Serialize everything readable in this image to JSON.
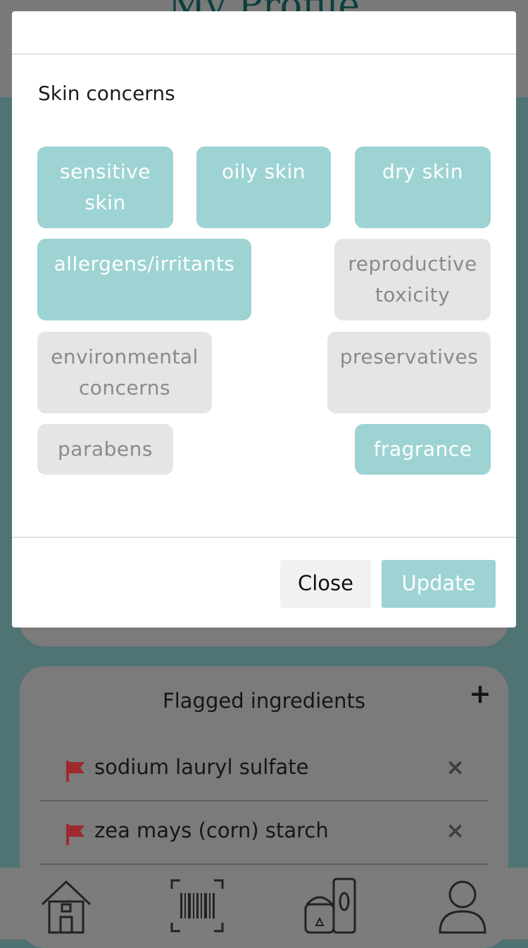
{
  "page": {
    "title": "My Profile"
  },
  "modal": {
    "section_title": "Skin concerns",
    "chips": [
      {
        "label": "sensitive skin",
        "selected": true
      },
      {
        "label": "oily skin",
        "selected": true
      },
      {
        "label": "dry skin",
        "selected": true
      },
      {
        "label": "allergens/irritants",
        "selected": true
      },
      {
        "label": "reproductive toxicity",
        "selected": false
      },
      {
        "label": "environmental concerns",
        "selected": false
      },
      {
        "label": "preservatives",
        "selected": false
      },
      {
        "label": "parabens",
        "selected": false
      },
      {
        "label": "fragrance",
        "selected": true
      }
    ],
    "close_label": "Close",
    "update_label": "Update"
  },
  "flagged": {
    "title": "Flagged ingredients",
    "add_label": "+",
    "items": [
      {
        "name": "sodium lauryl sulfate",
        "remove": "×"
      },
      {
        "name": "zea mays (corn) starch",
        "remove": "×"
      }
    ]
  },
  "tabbar": {
    "icons": [
      "home-icon",
      "barcode-scan-icon",
      "products-icon",
      "user-profile-icon"
    ]
  },
  "colors": {
    "accent": "#9ed3d3",
    "chip_off": "#e5e5e5",
    "flag": "#c0272d",
    "backdrop": "#507374"
  }
}
